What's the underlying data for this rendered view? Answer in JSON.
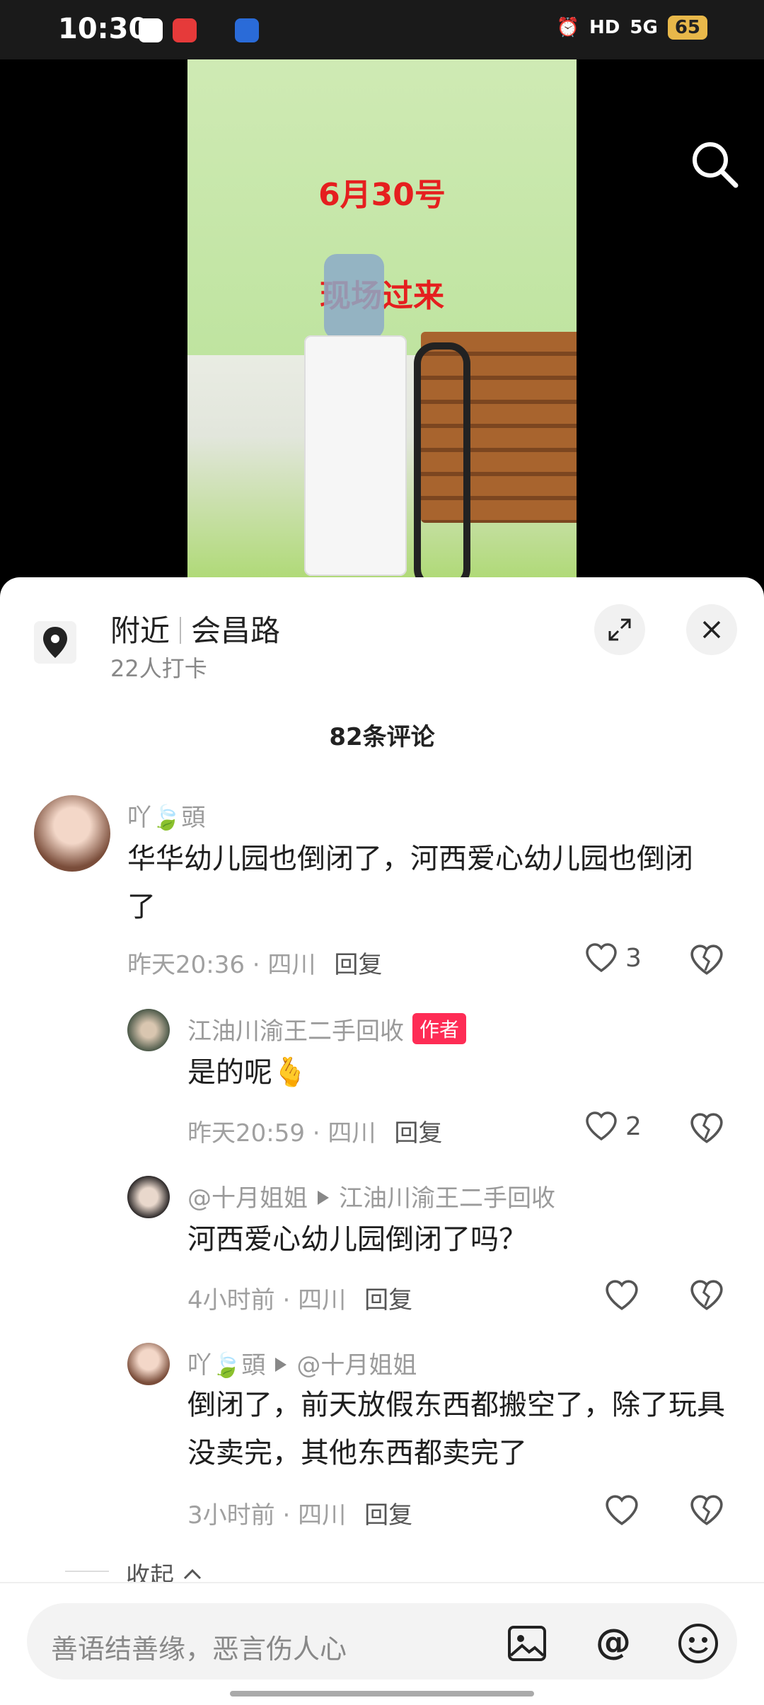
{
  "status_bar": {
    "time": "10:30",
    "battery": "65",
    "hd": "HD",
    "network": "5G"
  },
  "video": {
    "overlay_line1": "6月30号",
    "overlay_line2": "现场过来"
  },
  "location": {
    "label": "附近",
    "name": "会昌路",
    "checkins": "22人打卡"
  },
  "comments_count": "82条评论",
  "comments": [
    {
      "user": "吖🍃頭",
      "text": "华华幼儿园也倒闭了，河西爱心幼儿园也倒闭了",
      "time": "昨天20:36",
      "region": "四川",
      "reply": "回复",
      "likes": "3"
    },
    {
      "user": "江油川渝王二手回收",
      "author_tag": "作者",
      "text": "是的呢🫰",
      "time": "昨天20:59",
      "region": "四川",
      "reply": "回复",
      "likes": "2"
    },
    {
      "user": "@十月姐姐",
      "reply_to": "江油川渝王二手回收",
      "text": "河西爱心幼儿园倒闭了吗？",
      "time": "4小时前",
      "region": "四川",
      "reply": "回复"
    },
    {
      "user": "吖🍃頭",
      "reply_to": "@十月姐姐",
      "text": "倒闭了，前天放假东西都搬空了，除了玩具没卖完，其他东西都卖完了",
      "time": "3小时前",
      "region": "四川",
      "reply": "回复"
    }
  ],
  "collapse_label": "收起",
  "input": {
    "placeholder": "善语结善缘，恶言伤人心"
  },
  "colors": {
    "accent": "#fe2c55"
  }
}
